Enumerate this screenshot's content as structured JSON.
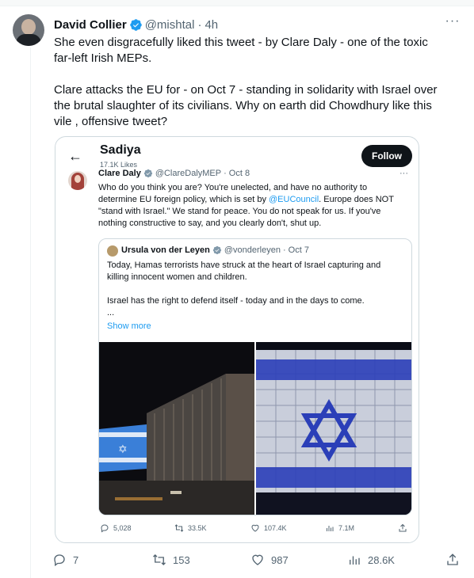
{
  "post": {
    "author_name": "David Collier",
    "author_handle": "@mishtal",
    "separator": "·",
    "time": "4h",
    "more": "···",
    "text_line1": "She even disgracefully liked this tweet - by Clare Daly - one of the toxic",
    "text_line2": "far-left Irish MEPs.",
    "text_line3": "Clare attacks the EU for - on Oct 7 - standing in solidarity with Israel over",
    "text_line4": "the brutal slaughter of its civilians.  Why on earth did Chowdhury like this",
    "text_line5": "vile , offensive tweet?",
    "actions": {
      "replies": "7",
      "reposts": "153",
      "likes": "987",
      "views": "28.6K"
    }
  },
  "screenshot": {
    "back_glyph": "←",
    "profile_name": "Sadiya",
    "profile_likes": "17.1K Likes",
    "follow_label": "Follow",
    "tweet": {
      "author_name": "Clare Daly",
      "author_handle": "@ClareDalyMEP",
      "date": "Oct 8",
      "more": "···",
      "line1": "Who do you think you are? You're unelected, and have no authority to",
      "line2_a": "determine EU foreign policy, which is set by ",
      "line2_link": "@EUCouncil",
      "line2_b": ". Europe does NOT",
      "line3": "\"stand with Israel.\" We stand for peace. You do not speak for us. If you've",
      "line4": "nothing constructive to say, and you clearly don't, shut up."
    },
    "quote": {
      "author_name": "Ursula von der Leyen",
      "author_handle": "@vonderleyen",
      "date": "Oct 7",
      "line1": "Today, Hamas terrorists have struck at the heart of Israel capturing and",
      "line2": "killing innocent women and children.",
      "line3": "Israel has the right to defend itself - today and in the days to come.",
      "line4": "...",
      "show_more": "Show more"
    },
    "stats": {
      "replies": "5,028",
      "reposts": "33.5K",
      "likes": "107.4K",
      "views": "7.1M"
    }
  },
  "colors": {
    "accent": "#1d9bf0",
    "text": "#0f1419",
    "muted": "#536471",
    "border": "#cfd9de"
  }
}
